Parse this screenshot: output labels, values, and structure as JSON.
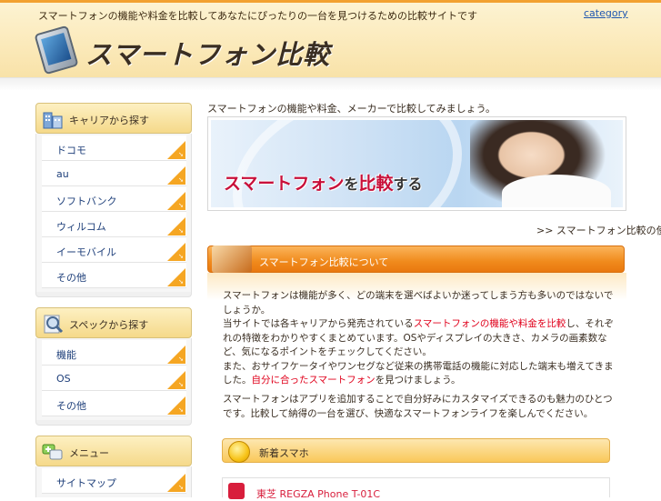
{
  "header": {
    "tagline": "スマートフォンの機能や料金を比較してあなたにぴったりの一台を見つけるための比較サイトです",
    "category_link": "category",
    "logo_text": "スマートフォン比較"
  },
  "sidebar": [
    {
      "title": "キャリアから探す",
      "icon": "building-icon",
      "items": [
        "ドコモ",
        "au",
        "ソフトバンク",
        "ウィルコム",
        "イーモバイル",
        "その他"
      ]
    },
    {
      "title": "スペックから探す",
      "icon": "magnifier-icon",
      "items": [
        "機能",
        "OS",
        "その他"
      ]
    },
    {
      "title": "メニュー",
      "icon": "chat-icon",
      "items": [
        "サイトマップ"
      ]
    }
  ],
  "main": {
    "intro": "スマートフォンの機能や料金、メーカーで比較してみましょう。",
    "banner": {
      "text_main": "スマートフォン",
      "text_particle": "を",
      "text_compare": "比較",
      "text_suffix": "する"
    },
    "more_link": ">> スマートフォン比較の使い方",
    "section_title": "スマートフォン比較について",
    "paragraph1": [
      {
        "text": "スマートフォンは機能が多く、どの端末を選べばよいか迷ってしまう方も多いのではないでしょうか。",
        "red": false
      },
      {
        "text": "当サイトでは各キャリアから発売されている",
        "red": false
      },
      {
        "text": "スマートフォンの機能や料金を比較",
        "red": true
      },
      {
        "text": "し、それぞれの特徴をわかりやすくまとめています。OSやディスプレイの大きさ、カメラの画素数など、気になるポイントをチェックしてください。",
        "red": false
      },
      {
        "text": "また、おサイフケータイやワンセグなど従来の携帯電話の機能に対応した端末も増えてきました。",
        "red": false
      },
      {
        "text": "自分に合ったスマートフォン",
        "red": true
      },
      {
        "text": "を見つけましょう。",
        "red": false
      }
    ],
    "paragraph2": "スマートフォンはアプリを追加することで自分好みにカスタマイズできるのも魅力のひとつです。比較して納得の一台を選び、快適なスマートフォンライフを楽しんでください。",
    "sub_title": "新着スマホ",
    "first_item": "東芝 REGZA Phone T-01C"
  },
  "colors": {
    "accent_orange": "#f08a1c",
    "link_blue": "#1e56b0",
    "highlight_red": "#e0001b"
  }
}
